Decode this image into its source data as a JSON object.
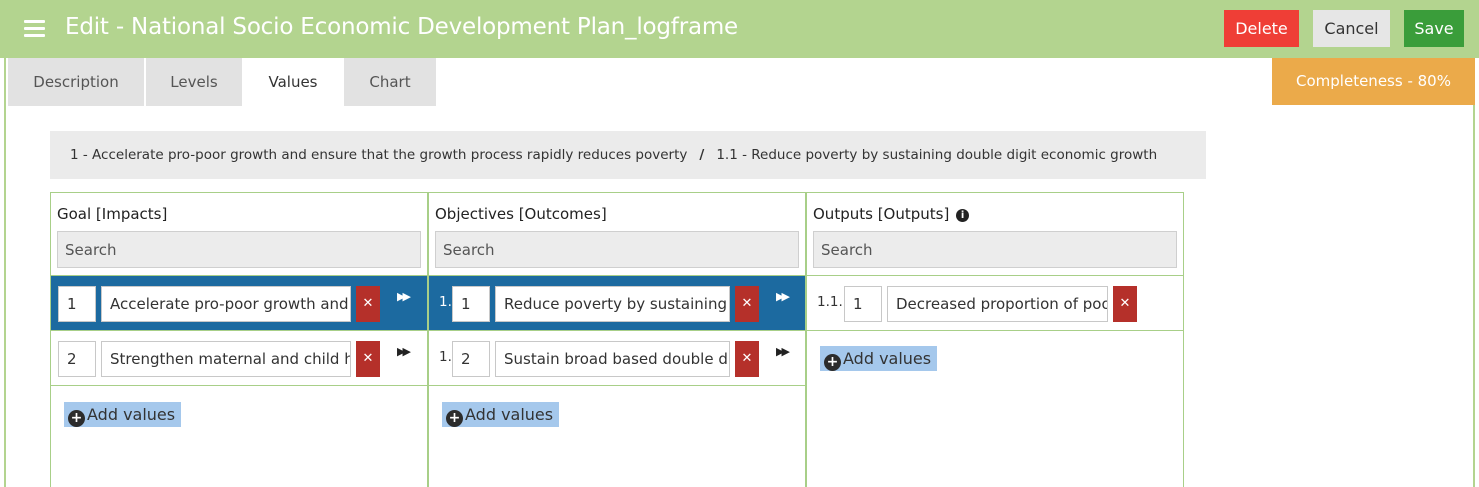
{
  "header": {
    "title": "Edit - National Socio Economic Development Plan_logframe",
    "delete_label": "Delete",
    "cancel_label": "Cancel",
    "save_label": "Save"
  },
  "tabs": [
    {
      "label": "Description",
      "active": false
    },
    {
      "label": "Levels",
      "active": false
    },
    {
      "label": "Values",
      "active": true
    },
    {
      "label": "Chart",
      "active": false
    }
  ],
  "completeness": "Completeness - 80%",
  "breadcrumb": {
    "items": [
      "1 - Accelerate pro-poor growth and ensure that the growth process rapidly reduces poverty",
      "1.1 - Reduce poverty by sustaining double digit economic growth"
    ],
    "separator": "/"
  },
  "columns": [
    {
      "title": "Goal [Impacts]",
      "search_placeholder": "Search",
      "add_label": "Add values",
      "rows": [
        {
          "prefix": "",
          "number": "1",
          "text": "Accelerate pro-poor growth and ensure that the growth process rapidly reduces poverty",
          "selected": true
        },
        {
          "prefix": "",
          "number": "2",
          "text": "Strengthen maternal and child health",
          "selected": false
        }
      ]
    },
    {
      "title": "Objectives [Outcomes]",
      "search_placeholder": "Search",
      "add_label": "Add values",
      "rows": [
        {
          "prefix": "1.",
          "number": "1",
          "text": "Reduce poverty by sustaining double digit economic growth",
          "selected": true
        },
        {
          "prefix": "1.",
          "number": "2",
          "text": "Sustain broad based double digit growth",
          "selected": false
        }
      ]
    },
    {
      "title": "Outputs [Outputs]",
      "search_placeholder": "Search",
      "add_label": "Add values",
      "rows": [
        {
          "prefix": "1.1.",
          "number": "1",
          "text": "Decreased proportion of poor people",
          "selected": false
        }
      ]
    }
  ],
  "colors": {
    "topbar": "#b3d48f",
    "delete": "#ef3e36",
    "save": "#3a9d3a",
    "completeness": "#ebaa4a",
    "selected_row": "#1c6aa0",
    "remove_button": "#b5302a",
    "add_values_bg": "#a5c8ec"
  }
}
